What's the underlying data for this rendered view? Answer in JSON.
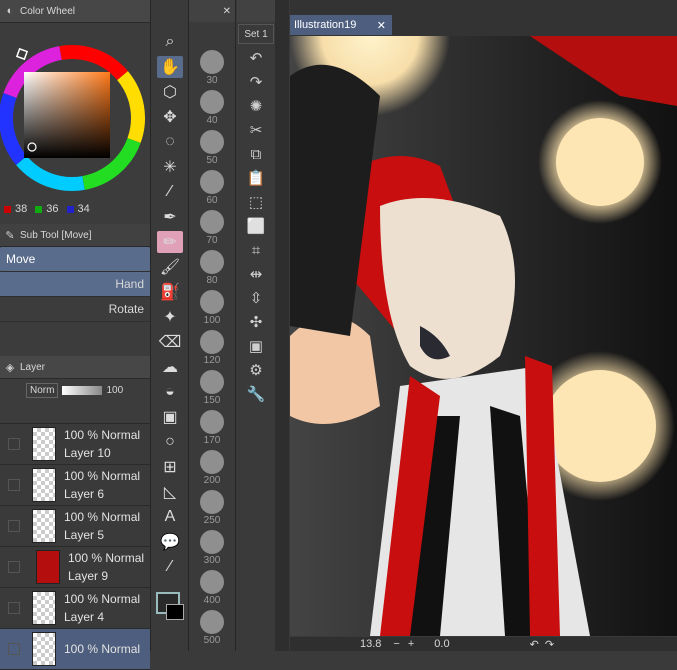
{
  "color_panel": {
    "title": "Color Wheel",
    "r": "38",
    "g": "36",
    "b": "34"
  },
  "sub_tool": {
    "title": "Sub Tool [Move]",
    "items": [
      {
        "label": "Move"
      },
      {
        "label": "Hand"
      },
      {
        "label": "Rotate"
      }
    ]
  },
  "layer_panel": {
    "title": "Layer",
    "blend_mode": "Norm",
    "opacity": "100",
    "layers": [
      {
        "mode": "100 % Normal",
        "name": "Layer 10"
      },
      {
        "mode": "100 % Normal",
        "name": "Layer 6"
      },
      {
        "mode": "100 % Normal",
        "name": "Layer 5"
      },
      {
        "mode": "100 % Normal",
        "name": "Layer 9"
      },
      {
        "mode": "100 % Normal",
        "name": "Layer 4"
      },
      {
        "mode": "100 % Normal",
        "name": ""
      }
    ]
  },
  "brush_sizes": [
    "30",
    "40",
    "50",
    "60",
    "70",
    "80",
    "100",
    "120",
    "150",
    "170",
    "200",
    "250",
    "300",
    "400",
    "500"
  ],
  "set_select": "Set 1",
  "document": {
    "tab_title": "Illustration19"
  },
  "status_bar": {
    "zoom": "13.8",
    "rotation": "0.0"
  },
  "colors": {
    "accent": "#5a6c8c",
    "red": "#b50e0e"
  }
}
